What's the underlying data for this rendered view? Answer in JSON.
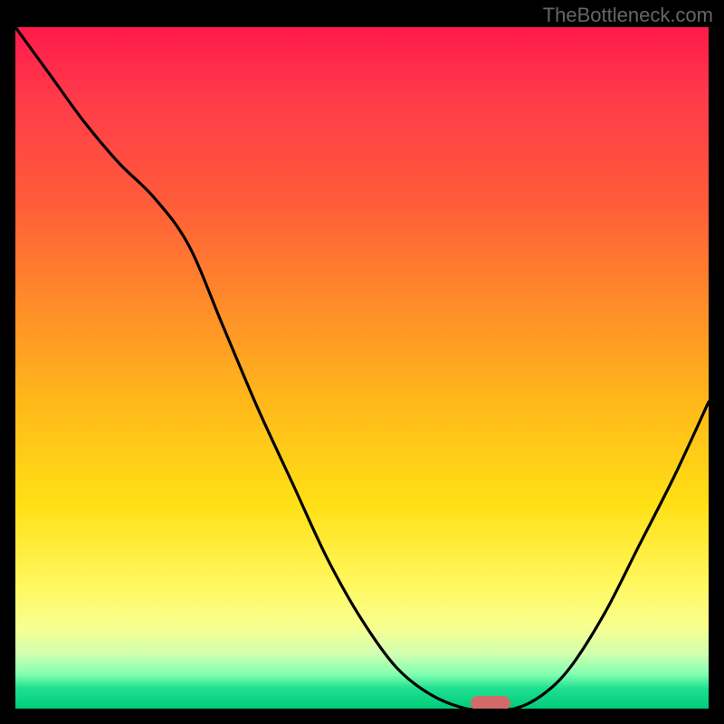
{
  "watermark": "TheBottleneck.com",
  "chart_data": {
    "type": "line",
    "title": "",
    "xlabel": "",
    "ylabel": "",
    "x": [
      0.0,
      0.05,
      0.1,
      0.15,
      0.2,
      0.25,
      0.3,
      0.35,
      0.4,
      0.45,
      0.5,
      0.55,
      0.6,
      0.65,
      0.68,
      0.72,
      0.76,
      0.8,
      0.85,
      0.9,
      0.95,
      1.0
    ],
    "values": [
      1.0,
      0.93,
      0.86,
      0.8,
      0.75,
      0.68,
      0.56,
      0.44,
      0.33,
      0.22,
      0.13,
      0.06,
      0.02,
      0.0,
      0.0,
      0.0,
      0.02,
      0.06,
      0.14,
      0.24,
      0.34,
      0.45
    ],
    "xlim": [
      0,
      1
    ],
    "ylim": [
      0,
      1
    ],
    "annotations": [
      {
        "type": "marker",
        "x": 0.685,
        "y": 0.0,
        "color": "#d26a6a"
      }
    ]
  }
}
